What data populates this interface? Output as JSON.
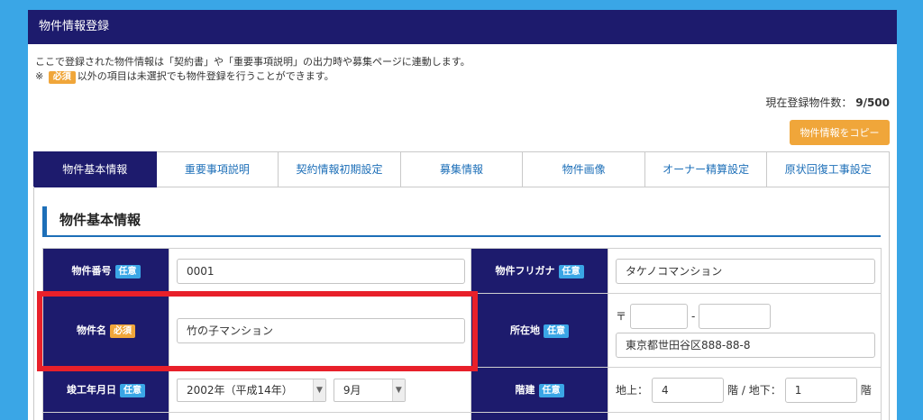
{
  "header": {
    "title": "物件情報登録"
  },
  "notice": {
    "line1": "ここで登録された物件情報は「契約書」や「重要事項説明」の出力時や募集ページに連動します。",
    "line2_prefix": "※",
    "required_badge": "必須",
    "line2_suffix": "以外の項目は未選択でも物件登録を行うことができます。"
  },
  "count": {
    "label": "現在登録物件数：",
    "value": "9/500"
  },
  "copy_button": "物件情報をコピー",
  "tabs": [
    {
      "label": "物件基本情報",
      "active": true
    },
    {
      "label": "重要事項説明",
      "active": false
    },
    {
      "label": "契約情報初期設定",
      "active": false
    },
    {
      "label": "募集情報",
      "active": false
    },
    {
      "label": "物件画像",
      "active": false
    },
    {
      "label": "オーナー精算設定",
      "active": false
    },
    {
      "label": "原状回復工事設定",
      "active": false
    }
  ],
  "section_title": "物件基本情報",
  "badges": {
    "optional": "任意",
    "required": "必須"
  },
  "fields": {
    "property_number": {
      "label": "物件番号",
      "value": "0001"
    },
    "property_kana": {
      "label": "物件フリガナ",
      "value": "タケノコマンション"
    },
    "property_name": {
      "label": "物件名",
      "value": "竹の子マンション"
    },
    "location": {
      "label": "所在地",
      "postal_mark": "〒",
      "postal_sep": "-",
      "postal1": "",
      "postal2": "",
      "address": "東京都世田谷区888-88-8"
    },
    "completion": {
      "label": "竣工年月日",
      "year": "2002年（平成14年）",
      "month": "9月"
    },
    "floors": {
      "label": "階建",
      "above_label": "地上：",
      "above": "4",
      "mid_label": "階 / 地下：",
      "below": "1",
      "suffix": "階"
    }
  },
  "colors": {
    "header": "#1d1b6d",
    "accent": "#1d6fb8",
    "optional": "#3aa6e6",
    "required": "#f0a63a",
    "highlight": "#e8202a"
  }
}
